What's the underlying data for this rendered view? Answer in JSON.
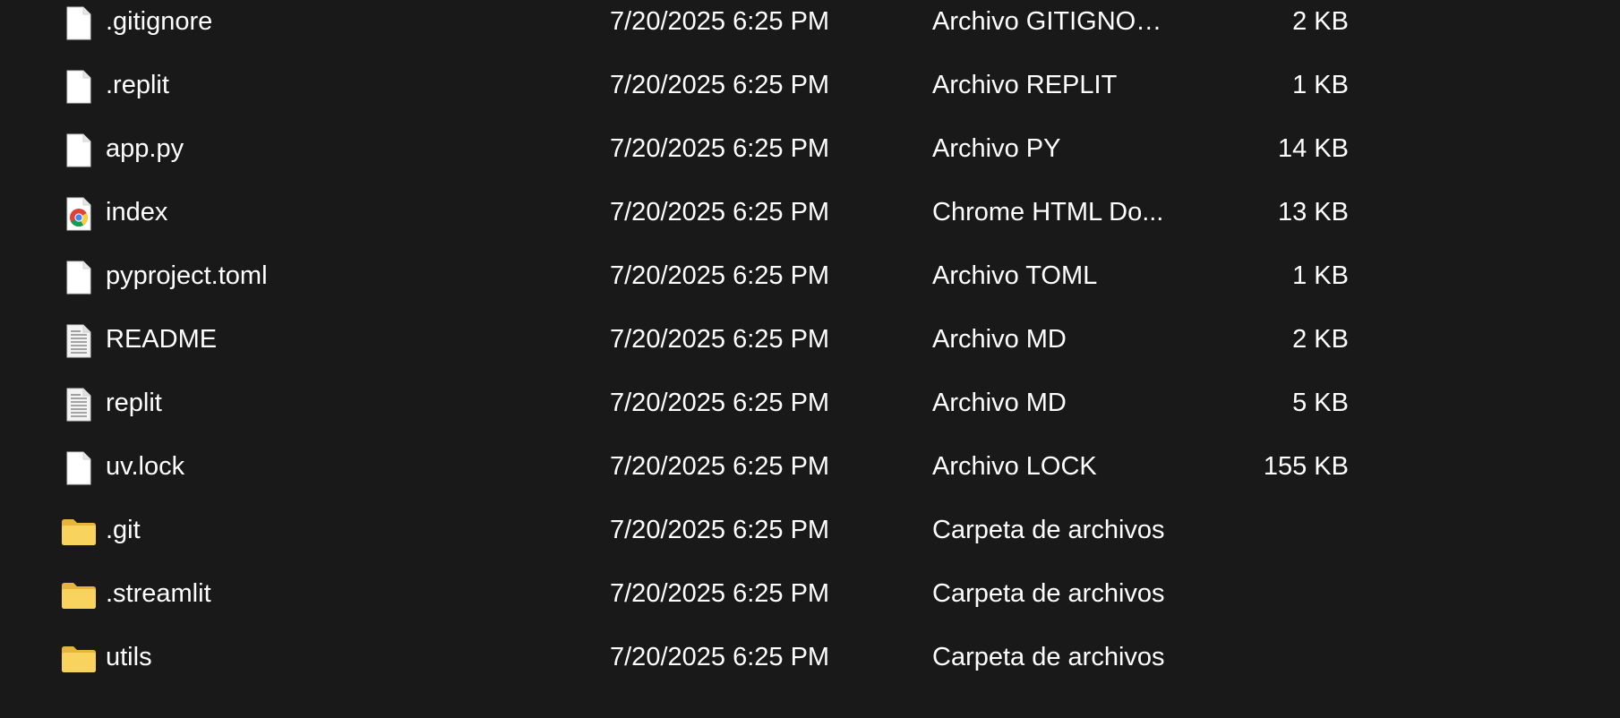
{
  "files": [
    {
      "icon": "file-icon",
      "name": ".gitignore",
      "date": "7/20/2025 6:25 PM",
      "type": "Archivo GITIGNORE",
      "size": "2 KB"
    },
    {
      "icon": "file-icon",
      "name": ".replit",
      "date": "7/20/2025 6:25 PM",
      "type": "Archivo REPLIT",
      "size": "1 KB"
    },
    {
      "icon": "file-icon",
      "name": "app.py",
      "date": "7/20/2025 6:25 PM",
      "type": "Archivo PY",
      "size": "14 KB"
    },
    {
      "icon": "chrome-html-icon",
      "name": "index",
      "date": "7/20/2025 6:25 PM",
      "type": "Chrome HTML Do...",
      "size": "13 KB"
    },
    {
      "icon": "file-icon",
      "name": "pyproject.toml",
      "date": "7/20/2025 6:25 PM",
      "type": "Archivo TOML",
      "size": "1 KB"
    },
    {
      "icon": "text-document-icon",
      "name": "README",
      "date": "7/20/2025 6:25 PM",
      "type": "Archivo MD",
      "size": "2 KB"
    },
    {
      "icon": "text-document-icon",
      "name": "replit",
      "date": "7/20/2025 6:25 PM",
      "type": "Archivo MD",
      "size": "5 KB"
    },
    {
      "icon": "file-icon",
      "name": "uv.lock",
      "date": "7/20/2025 6:25 PM",
      "type": "Archivo LOCK",
      "size": "155 KB"
    },
    {
      "icon": "folder-icon",
      "name": ".git",
      "date": "7/20/2025 6:25 PM",
      "type": "Carpeta de archivos",
      "size": ""
    },
    {
      "icon": "folder-icon",
      "name": ".streamlit",
      "date": "7/20/2025 6:25 PM",
      "type": "Carpeta de archivos",
      "size": ""
    },
    {
      "icon": "folder-icon",
      "name": "utils",
      "date": "7/20/2025 6:25 PM",
      "type": "Carpeta de archivos",
      "size": ""
    }
  ],
  "colors": {
    "background": "#191919",
    "text": "#ffffff",
    "folder": "#f8d35e"
  }
}
